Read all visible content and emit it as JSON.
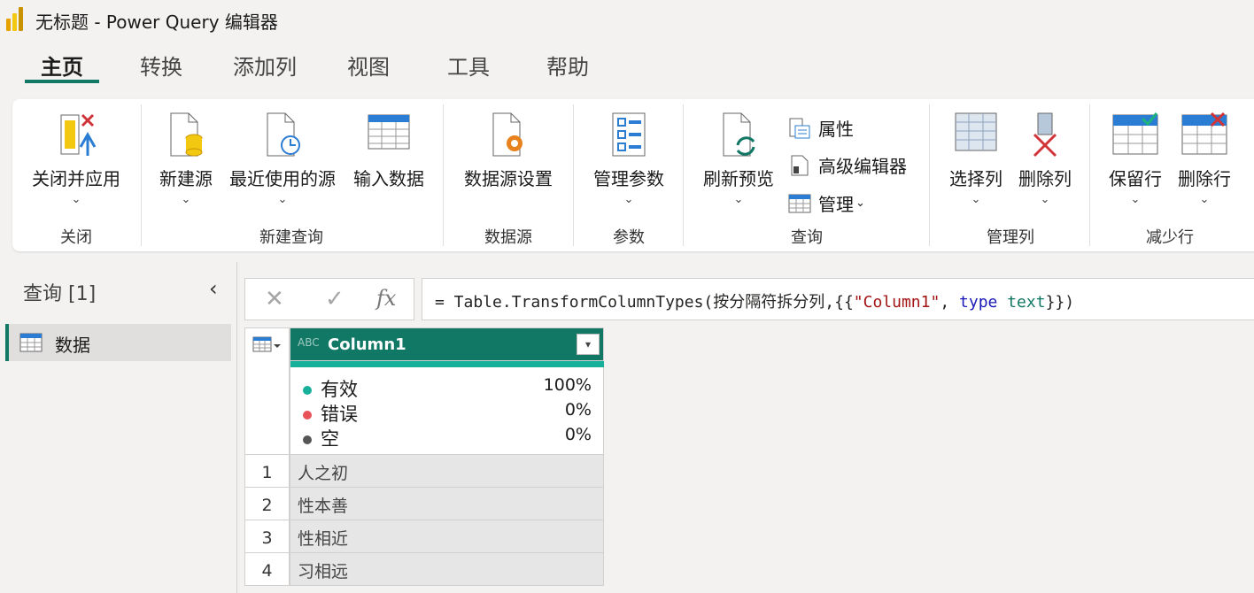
{
  "window": {
    "title": "无标题 - Power Query 编辑器"
  },
  "tabs": [
    "主页",
    "转换",
    "添加列",
    "视图",
    "工具",
    "帮助"
  ],
  "ribbon": {
    "close_apply": "关闭并应用",
    "new_source": "新建源",
    "recent_sources": "最近使用的源",
    "enter_data": "输入数据",
    "datasource_settings": "数据源设置",
    "manage_params": "管理参数",
    "refresh_preview": "刷新预览",
    "properties": "属性",
    "advanced_editor": "高级编辑器",
    "manage": "管理",
    "choose_columns": "选择列",
    "remove_columns": "删除列",
    "keep_rows": "保留行",
    "remove_rows": "删除行",
    "chevron": "⌄",
    "groups": [
      "关闭",
      "新建查询",
      "数据源",
      "参数",
      "查询",
      "管理列",
      "减少行"
    ]
  },
  "queries": {
    "header": "查询 [1]",
    "collapse": "‹",
    "items": [
      {
        "label": "数据"
      }
    ]
  },
  "formula_bar": {
    "cancel": "✕",
    "confirm": "✓",
    "fx": "fx",
    "prefix": "= Table.TransformColumnTypes(按分隔符拆分列,{{",
    "string": "\"Column1\"",
    "comma": ", ",
    "kw": "type",
    "type": "text",
    "suffix": "}})"
  },
  "column": {
    "type_icon": "ABC",
    "name": "Column1",
    "dropdown": "▾"
  },
  "quality": [
    {
      "label": "有效",
      "pct": "100%",
      "color": "#17b09b"
    },
    {
      "label": "错误",
      "pct": "0%",
      "color": "#e8535a"
    },
    {
      "label": "空",
      "pct": "0%",
      "color": "#555555"
    }
  ],
  "rows": [
    {
      "n": "1",
      "v": "人之初"
    },
    {
      "n": "2",
      "v": "性本善"
    },
    {
      "n": "3",
      "v": "性相近"
    },
    {
      "n": "4",
      "v": "习相远"
    }
  ],
  "colors": {
    "accent": "#117865"
  }
}
